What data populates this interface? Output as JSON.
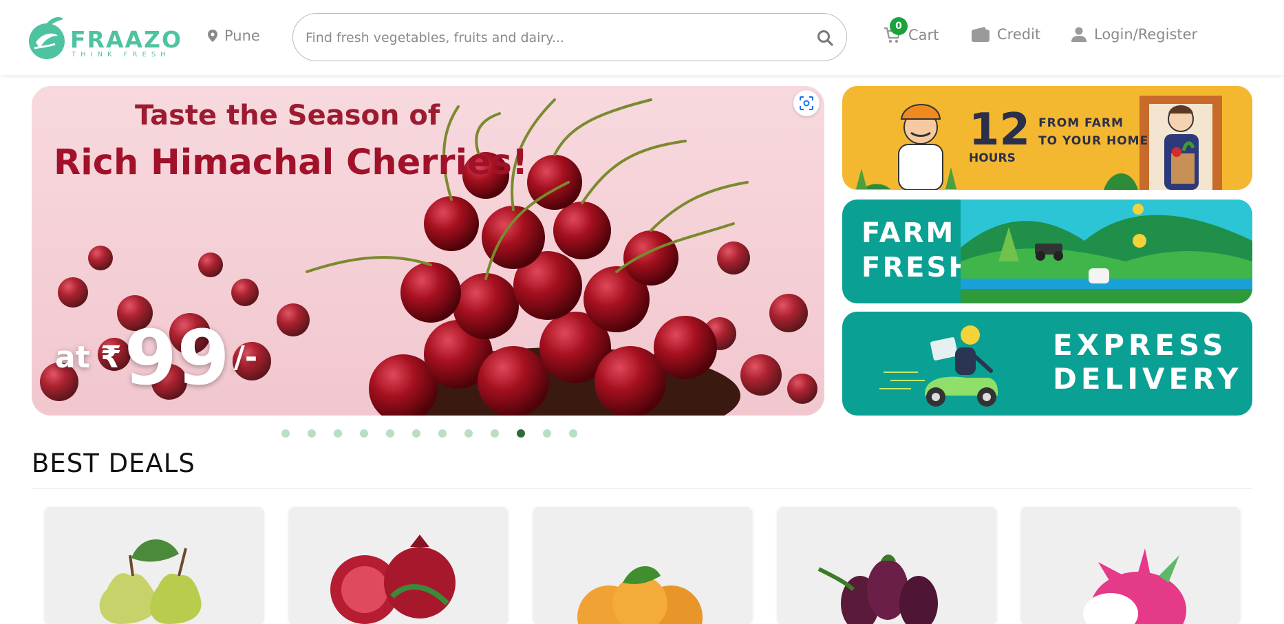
{
  "header": {
    "brand": "FRAAZO",
    "tagline": "THINK FRESH",
    "location": "Pune",
    "search_placeholder": "Find fresh vegetables, fruits and dairy...",
    "cart_label": "Cart",
    "cart_count": "0",
    "credit_label": "Credit",
    "login_label": "Login/Register"
  },
  "hero": {
    "line1": "Taste the Season of",
    "line2": "Rich Himachal Cherries!",
    "price_prefix": "at ₹",
    "price_value": "99",
    "price_suffix": "/-"
  },
  "promos": {
    "p1_number": "12",
    "p1_hours": "HOURS",
    "p1_line1": "FROM FARM",
    "p1_line2": "TO YOUR HOME",
    "p2_line1": "FARM",
    "p2_line2": "FRESH",
    "p3_line1": "EXPRESS",
    "p3_line2": "DELIVERY"
  },
  "carousel": {
    "dot_count": 12,
    "active_index": 9
  },
  "best_deals": {
    "title": "BEST DEALS",
    "items": [
      "pear",
      "pomegranate",
      "orange",
      "brinjal",
      "dragon fruit"
    ]
  },
  "colors": {
    "brand": "#4fc3a1",
    "cart_badge": "#1aa33a",
    "promo_yellow": "#f4b730",
    "promo_teal": "#0aa094",
    "hero_text": "#a1122a"
  }
}
